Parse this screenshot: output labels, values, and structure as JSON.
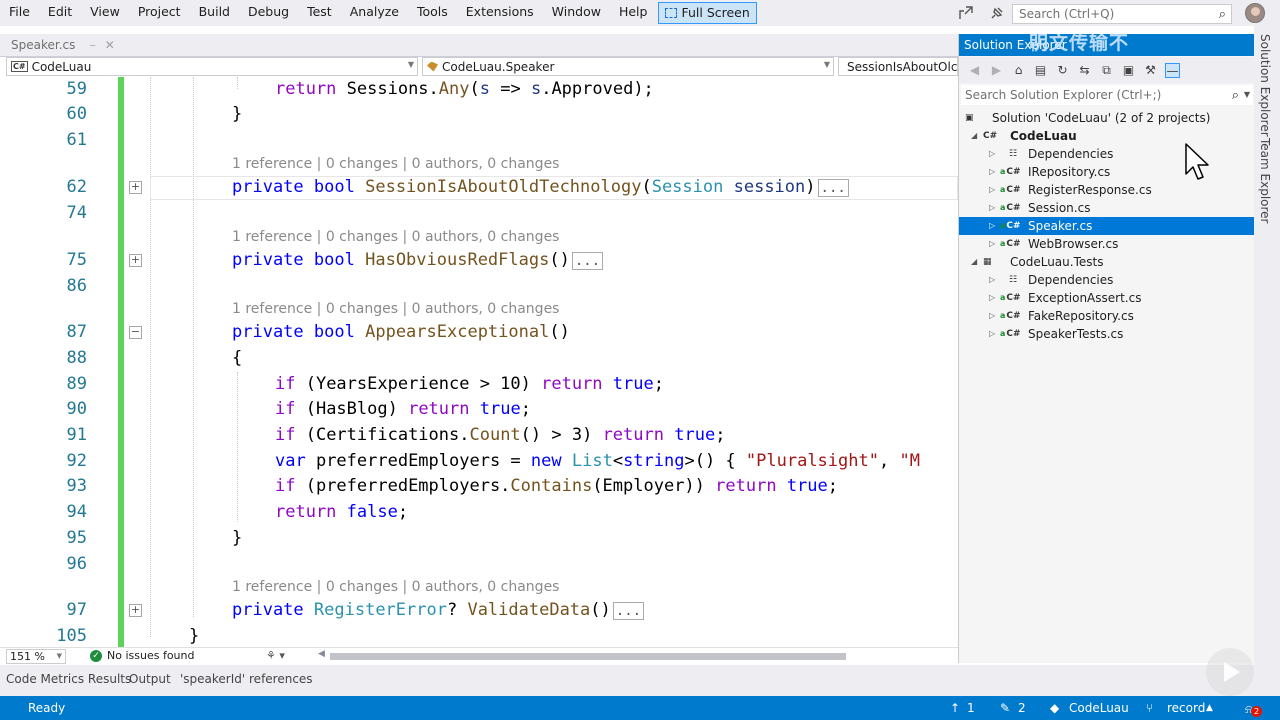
{
  "menu": [
    "File",
    "Edit",
    "View",
    "Project",
    "Build",
    "Debug",
    "Test",
    "Analyze",
    "Tools",
    "Extensions",
    "Window",
    "Help"
  ],
  "full_screen_label": "Full Screen",
  "search": {
    "placeholder": "Search (Ctrl+Q)"
  },
  "doc_tab": {
    "label": "Speaker.cs"
  },
  "nav": {
    "project": "CodeLuau",
    "class": "CodeLuau.Speaker",
    "member": "SessionIsAboutOlc"
  },
  "code_lens": "1 reference | 0 changes | 0 authors, 0 changes",
  "line_numbers": {
    "l59": "59",
    "l60": "60",
    "l61": "61",
    "l62": "62",
    "l74": "74",
    "l75": "75",
    "l86": "86",
    "l87": "87",
    "l88": "88",
    "l89": "89",
    "l90": "90",
    "l91": "91",
    "l92": "92",
    "l93": "93",
    "l94": "94",
    "l95": "95",
    "l96": "96",
    "l97": "97",
    "l105": "105"
  },
  "code": {
    "l59": {
      "ret": "return",
      "rest1": " Sessions.",
      "any": "Any",
      "rest2": "(",
      "s1": "s",
      "arrow": " => ",
      "s2": "s",
      "rest3": ".Approved);"
    },
    "l60": "}",
    "l62": {
      "private": "private",
      "bool": "bool",
      "name": "SessionIsAboutOldTechnology",
      "open": "(",
      "type": "Session",
      "param": "session",
      "close": ")",
      "collapsed": "..."
    },
    "l75": {
      "private": "private",
      "bool": "bool",
      "name": "HasObviousRedFlags",
      "parens": "()",
      "collapsed": "..."
    },
    "l87": {
      "private": "private",
      "bool": "bool",
      "name": "AppearsExceptional",
      "parens": "()"
    },
    "l88": "{",
    "l89": {
      "if": "if",
      "a": " (YearsExperience > 10) ",
      "ret": "return",
      "val": "true",
      "end": ";"
    },
    "l90": {
      "if": "if",
      "a": " (HasBlog) ",
      "ret": "return",
      "val": "true",
      "end": ";"
    },
    "l91": {
      "if": "if",
      "a": " (Certifications.",
      "m": "Count",
      "b": "() > 3) ",
      "ret": "return",
      "val": "true",
      "end": ";"
    },
    "l92": {
      "var": "var",
      "a": " preferredEmployers = ",
      "new": "new",
      "list": "List",
      "lt": "<",
      "str": "string",
      "gt": ">() { ",
      "s1": "\"Pluralsight\"",
      "comma": ", ",
      "s2": "\"M"
    },
    "l93": {
      "if": "if",
      "a": " (preferredEmployers.",
      "m": "Contains",
      "b": "(Employer)) ",
      "ret": "return",
      "val": "true",
      "end": ";"
    },
    "l94": {
      "ret": "return",
      "val": "false",
      "end": ";"
    },
    "l95": "}",
    "l97": {
      "private": "private",
      "type": "RegisterError",
      "q": "? ",
      "name": "ValidateData",
      "parens": "()",
      "collapsed": "..."
    },
    "l105": "}"
  },
  "editor_status": {
    "zoom": "151 %",
    "issues": "No issues found"
  },
  "tool_tabs": [
    "Code Metrics Results",
    "Output",
    "'speakerId' references"
  ],
  "status_bar": {
    "ready": "Ready",
    "up": "1",
    "edits": "2",
    "repo": "CodeLuau",
    "branch": "record",
    "notifications": "2"
  },
  "solution_explorer": {
    "title": "Solution Explorer",
    "search_placeholder": "Search Solution Explorer (Ctrl+;)",
    "solution": "Solution 'CodeLuau' (2 of 2 projects)",
    "project1": "CodeLuau",
    "project1_items": [
      "Dependencies",
      "IRepository.cs",
      "RegisterResponse.cs",
      "Session.cs",
      "Speaker.cs",
      "WebBrowser.cs"
    ],
    "project2": "CodeLuau.Tests",
    "project2_items": [
      "Dependencies",
      "ExceptionAssert.cs",
      "FakeRepository.cs",
      "SpeakerTests.cs"
    ]
  },
  "side_tabs": [
    "Solution Explorer",
    "Team Explorer"
  ],
  "overlay_text": "明文传输不"
}
